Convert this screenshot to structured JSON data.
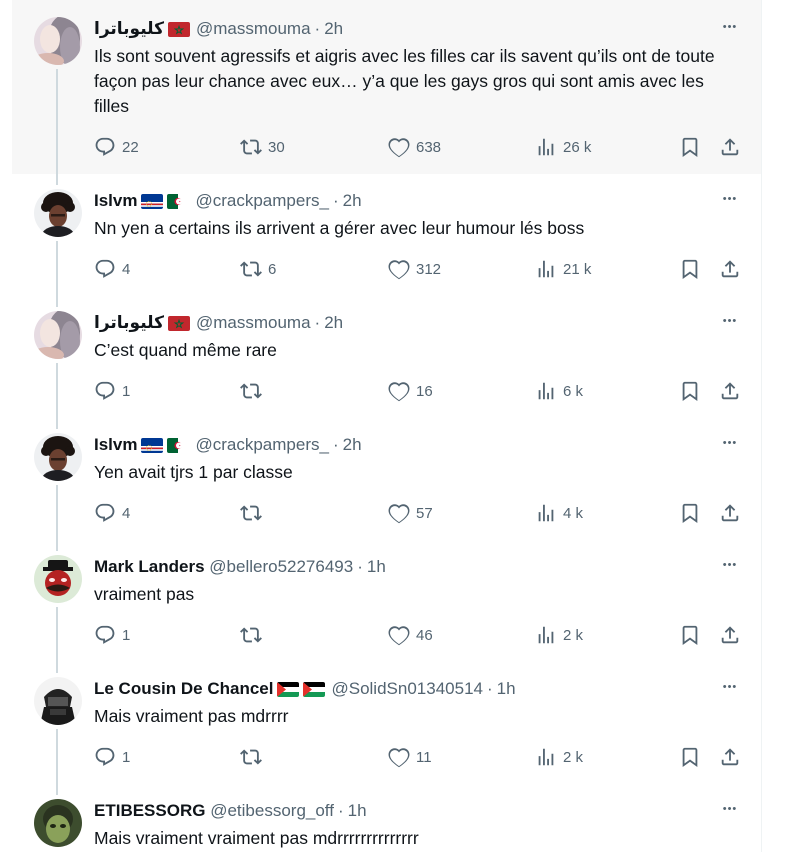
{
  "tweets": [
    {
      "name": "كليوباترا",
      "handle": "@massmouma",
      "sep": "·",
      "time": "2h",
      "flags": [
        "morocco"
      ],
      "avatar": "blurred-woman-avatar",
      "text": "Ils sont souvent agressifs et aigris avec les filles car ils savent qu’ils ont de toute façon pas leur chance avec eux… y’a que les gays gros qui sont amis avec les filles",
      "reply": "22",
      "retweet": "30",
      "like": "638",
      "views": "26 k",
      "highlighted": true
    },
    {
      "name": "Islvm",
      "handle": "@crackpampers_",
      "sep": "·",
      "time": "2h",
      "flags": [
        "cape-verde",
        "algeria"
      ],
      "avatar": "curly-hair-man-avatar",
      "text": "Nn yen a certains ils arrivent a gérer avec leur humour lés boss",
      "reply": "4",
      "retweet": "6",
      "like": "312",
      "views": "21 k"
    },
    {
      "name": "كليوباترا",
      "handle": "@massmouma",
      "sep": "·",
      "time": "2h",
      "flags": [
        "morocco"
      ],
      "avatar": "blurred-woman-avatar",
      "text": "C’est quand même rare",
      "reply": "1",
      "retweet": "",
      "like": "16",
      "views": "6 k"
    },
    {
      "name": "Islvm",
      "handle": "@crackpampers_",
      "sep": "·",
      "time": "2h",
      "flags": [
        "cape-verde",
        "algeria"
      ],
      "avatar": "curly-hair-man-avatar",
      "text": "Yen avait tjrs 1 par classe",
      "reply": "4",
      "retweet": "",
      "like": "57",
      "views": "4 k"
    },
    {
      "name": "Mark Landers",
      "handle": "@bellero52276493",
      "sep": "·",
      "time": "1h",
      "flags": [],
      "avatar": "red-devil-avatar",
      "text": "vraiment pas",
      "reply": "1",
      "retweet": "",
      "like": "46",
      "views": "2 k"
    },
    {
      "name": "Le Cousin De Chancel",
      "handle": "@SolidSn01340514",
      "sep": "·",
      "time": "1h",
      "flags": [
        "palestine",
        "palestine"
      ],
      "avatar": "soldier-avatar",
      "text": "Mais vraiment pas mdrrrr",
      "reply": "1",
      "retweet": "",
      "like": "11",
      "views": "2 k"
    },
    {
      "name": "ETIBESSORG",
      "handle": "@etibessorg_off",
      "sep": "·",
      "time": "1h",
      "flags": [],
      "avatar": "green-face-avatar",
      "text": "Mais vraiment vraiment pas mdrrrrrrrrrrrrrr",
      "reply": "",
      "retweet": "",
      "like": "",
      "views": ""
    }
  ],
  "icons": {
    "reply": "reply-icon",
    "retweet": "retweet-icon",
    "like": "heart-icon",
    "views": "views-icon",
    "bookmark": "bookmark-icon",
    "share": "share-icon",
    "more": "more-icon"
  },
  "colors": {
    "text": "#0f1419",
    "secondary": "#536471",
    "thread_line": "#cfd9de",
    "highlight_bg": "#f7f7f7"
  }
}
